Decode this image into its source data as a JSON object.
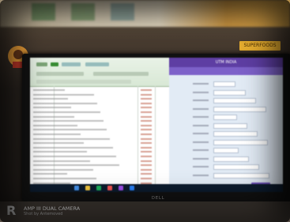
{
  "photo": {
    "monitor_brand": "DELL",
    "right_window_title": "UTM INDIA",
    "store_sign": "SUPERFOODS",
    "watermark": {
      "logo": "R",
      "line1": "AMP III DUAL CAMERA",
      "line2": "Shot by Antemoved"
    }
  }
}
